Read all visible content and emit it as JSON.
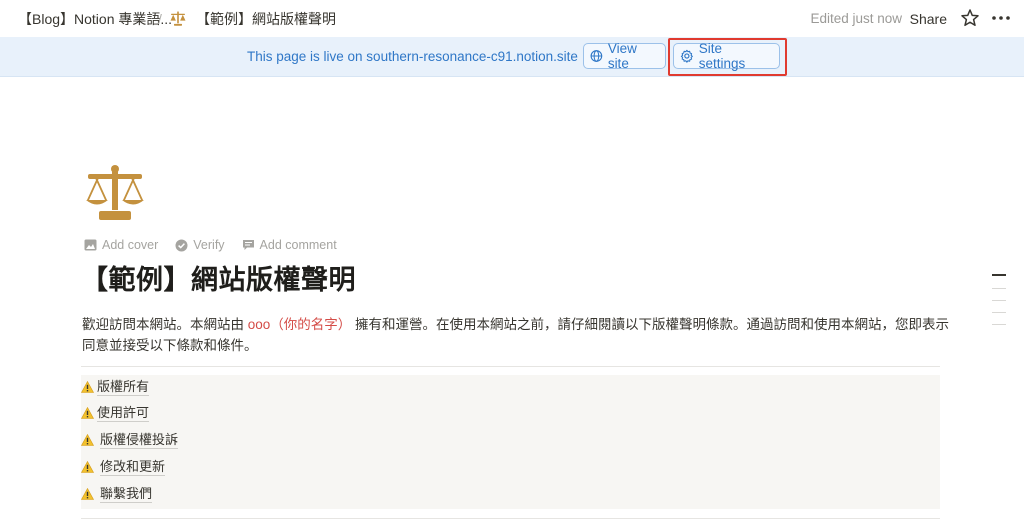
{
  "topbar": {
    "crumb_parent": "【Blog】Notion 專業語...",
    "crumb_sep": "/",
    "crumb_current": "【範例】網站版權聲明",
    "edited": "Edited just now",
    "share": "Share"
  },
  "banner": {
    "text": "This page is live on southern-resonance-c91.notion.site",
    "view_site": "View site",
    "site_settings": "Site settings"
  },
  "page": {
    "icon": "scales-icon",
    "actions": {
      "add_cover": "Add cover",
      "verify": "Verify",
      "add_comment": "Add comment"
    },
    "title": "【範例】網站版權聲明",
    "intro_before": "歡迎訪問本網站。本網站由 ",
    "intro_red": "ooo（你的名字）",
    "intro_after": " 擁有和運營。在使用本網站之前，請仔細閱讀以下版權聲明條款。通過訪問和使用本網站，您即表示同意並接受以下條款和條件。",
    "toc": [
      "版權所有",
      "使用許可",
      "版權侵權投訴",
      "修改和更新",
      "聯繫我們"
    ]
  },
  "colors": {
    "accent": "#2f77c7",
    "highlight": "#e03a2f",
    "warning": "#f2c12e",
    "icon_gold": "#c4913e"
  }
}
